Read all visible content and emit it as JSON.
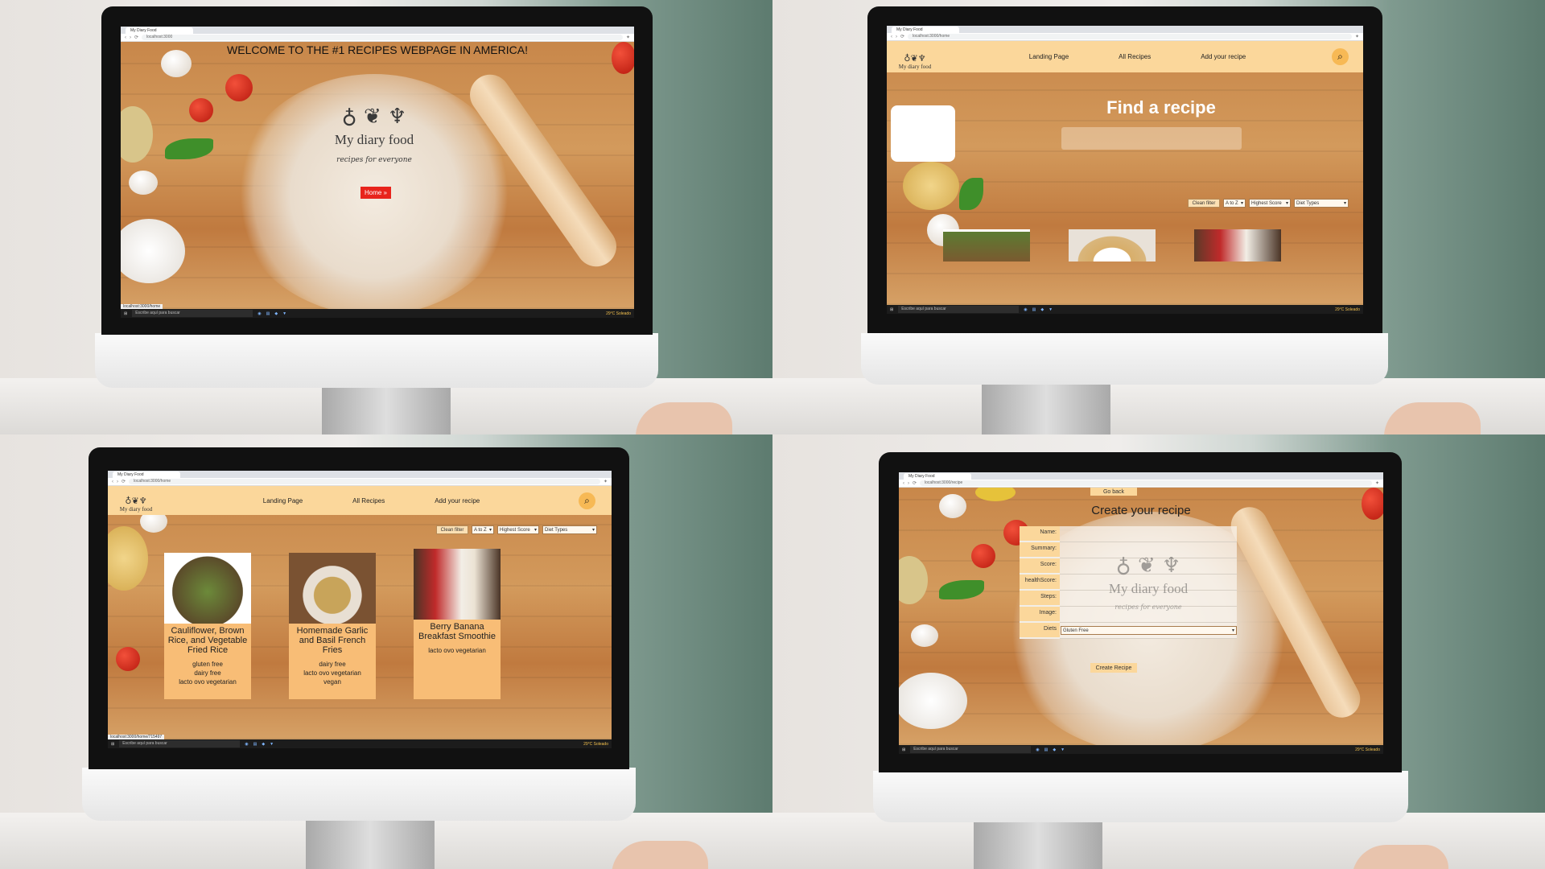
{
  "browser": {
    "tab_title": "My Diary Food",
    "urls": [
      "localhost:3000",
      "localhost:3000/home",
      "localhost:3000/home",
      "localhost:3000/recipe"
    ]
  },
  "taskbar": {
    "search_placeholder": "Escribe aquí para buscar",
    "weather": "29°C Soleado"
  },
  "landing": {
    "heading": "WELCOME TO THE #1 RECIPES WEBPAGE IN AMERICA!",
    "logo_name": "My diary food",
    "logo_tagline": "recipes for everyone",
    "home_button": "Home »",
    "status_url": "localhost:3000/home"
  },
  "nav": {
    "brand": "My diary food",
    "links": [
      "Landing Page",
      "All Recipes",
      "Add your recipe"
    ]
  },
  "home": {
    "hero_title": "Find a recipe",
    "clean_filter": "Clean filter",
    "sort_az": "A to Z",
    "sort_score": "Highest Score",
    "diet_types": "Diet Types"
  },
  "recipes": [
    {
      "title": "Cauliflower, Brown Rice, and Vegetable Fried Rice",
      "diets": [
        "gluten free",
        "dairy free",
        "lacto ovo vegetarian"
      ]
    },
    {
      "title": "Homemade Garlic and Basil French Fries",
      "diets": [
        "dairy free",
        "lacto ovo vegetarian",
        "vegan"
      ]
    },
    {
      "title": "Berry Banana Breakfast Smoothie",
      "diets": [
        "lacto ovo vegetarian"
      ]
    }
  ],
  "recipes_status_url": "localhost:3000/home/715497",
  "create": {
    "go_back": "Go back",
    "title": "Create your recipe",
    "fields": [
      "Name:",
      "Summary:",
      "Score:",
      "healthScore:",
      "Steps:",
      "Image:",
      "Diets"
    ],
    "diet_default": "Gluten Free",
    "submit": "Create Recipe"
  },
  "colors": {
    "nav_bg": "#fbd79b",
    "card_bg": "#f8bd76",
    "home_button": "#e8241c",
    "search_button": "#f7b955"
  }
}
